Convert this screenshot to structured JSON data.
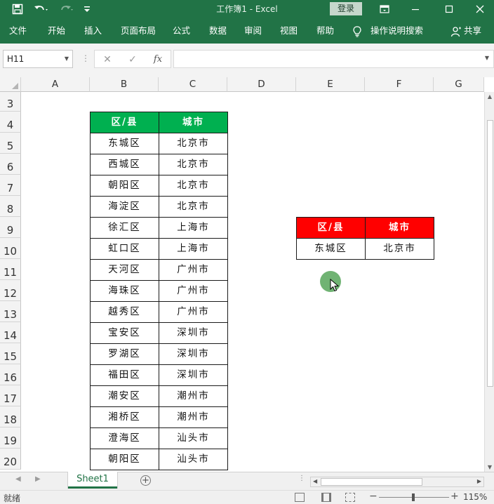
{
  "window": {
    "title": "工作簿1  -  Excel",
    "login_label": "登录",
    "icons": [
      "save-icon",
      "undo-icon",
      "redo-icon",
      "customize-icon",
      "ribbon-display-icon",
      "minimize-icon",
      "maximize-icon",
      "close-icon"
    ]
  },
  "ribbon": {
    "tabs": [
      "文件",
      "开始",
      "插入",
      "页面布局",
      "公式",
      "数据",
      "审阅",
      "视图",
      "帮助"
    ],
    "tell_me": "操作说明搜索",
    "share": "共享"
  },
  "formula_bar": {
    "name_box": "H11",
    "formula": "",
    "fx_label": "fx"
  },
  "columns": [
    "A",
    "B",
    "C",
    "D",
    "E",
    "F",
    "G"
  ],
  "rows": [
    "3",
    "4",
    "5",
    "6",
    "7",
    "8",
    "9",
    "10",
    "11",
    "12",
    "13",
    "14",
    "15",
    "16",
    "17",
    "18",
    "19",
    "20"
  ],
  "table_main": {
    "headers": [
      "区/县",
      "城市"
    ],
    "rows": [
      [
        "东城区",
        "北京市"
      ],
      [
        "西城区",
        "北京市"
      ],
      [
        "朝阳区",
        "北京市"
      ],
      [
        "海淀区",
        "北京市"
      ],
      [
        "徐汇区",
        "上海市"
      ],
      [
        "虹口区",
        "上海市"
      ],
      [
        "天河区",
        "广州市"
      ],
      [
        "海珠区",
        "广州市"
      ],
      [
        "越秀区",
        "广州市"
      ],
      [
        "宝安区",
        "深圳市"
      ],
      [
        "罗湖区",
        "深圳市"
      ],
      [
        "福田区",
        "深圳市"
      ],
      [
        "潮安区",
        "潮州市"
      ],
      [
        "湘桥区",
        "潮州市"
      ],
      [
        "澄海区",
        "汕头市"
      ],
      [
        "朝阳区",
        "汕头市"
      ]
    ],
    "header_color": "#00b050"
  },
  "table_lookup": {
    "headers": [
      "区/县",
      "城市"
    ],
    "rows": [
      [
        "东城区",
        "北京市"
      ]
    ],
    "header_color": "#ff0000"
  },
  "sheets": [
    "Sheet1"
  ],
  "status": {
    "ready": "就绪",
    "zoom": "115%"
  }
}
